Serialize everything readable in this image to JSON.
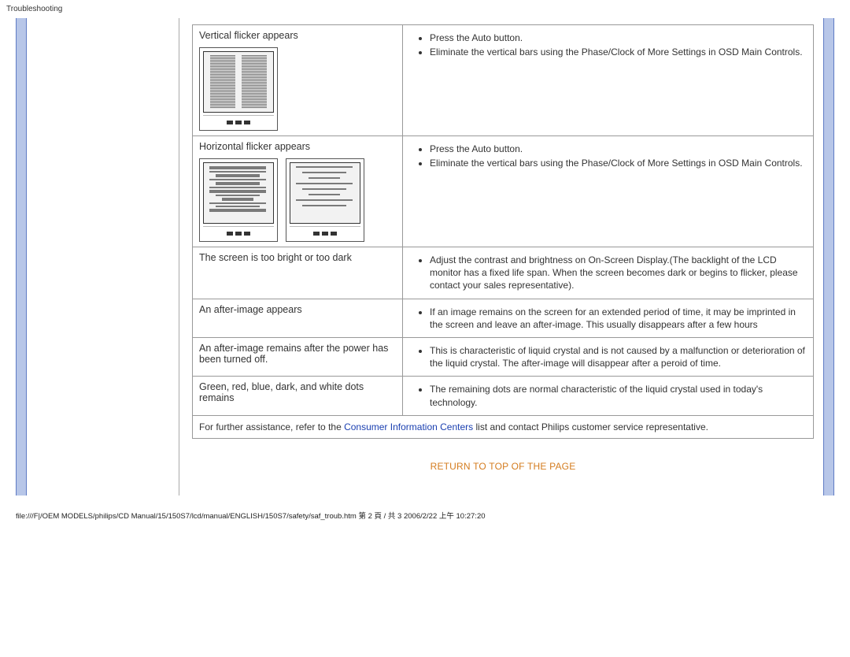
{
  "header": {
    "crumb": "Troubleshooting"
  },
  "rows": {
    "r1": {
      "title": "Vertical flicker appears",
      "solutions": [
        "Press the Auto button.",
        "Eliminate the vertical bars using the Phase/Clock of More Settings in OSD Main Controls."
      ]
    },
    "r2": {
      "title": "Horizontal flicker appears",
      "solutions": [
        "Press the Auto button.",
        "Eliminate the vertical bars using the Phase/Clock of More Settings in OSD Main Controls."
      ]
    },
    "r3": {
      "title": "The screen is too bright or too dark",
      "solution": "Adjust the contrast and brightness on On-Screen Display.(The backlight of the LCD monitor has a fixed life span. When the screen becomes dark or begins to flicker, please contact your sales representative)."
    },
    "r4": {
      "title": "An after-image appears",
      "solution": "If an image remains on the screen for an extended period of time, it may be imprinted in the screen and leave an after-image. This usually disappears after a few hours"
    },
    "r5": {
      "title": "An after-image remains after the power has been turned off.",
      "solution": "This is characteristic of liquid crystal and is not caused by a malfunction or deterioration of the liquid crystal. The after-image will disappear after a peroid of time."
    },
    "r6": {
      "title": "Green, red, blue, dark, and white dots remains",
      "solution": "The remaining dots are normal characteristic of the liquid crystal used in today's technology."
    },
    "footer": {
      "pre": "For further assistance, refer to the ",
      "link": "Consumer Information Centers",
      "post": " list and contact Philips customer service representative."
    }
  },
  "return_link": "RETURN TO TOP OF THE PAGE",
  "page_footer": "file:///F|/OEM MODELS/philips/CD Manual/15/150S7/lcd/manual/ENGLISH/150S7/safety/saf_troub.htm 第 2 頁 / 共 3 2006/2/22 上午 10:27:20"
}
